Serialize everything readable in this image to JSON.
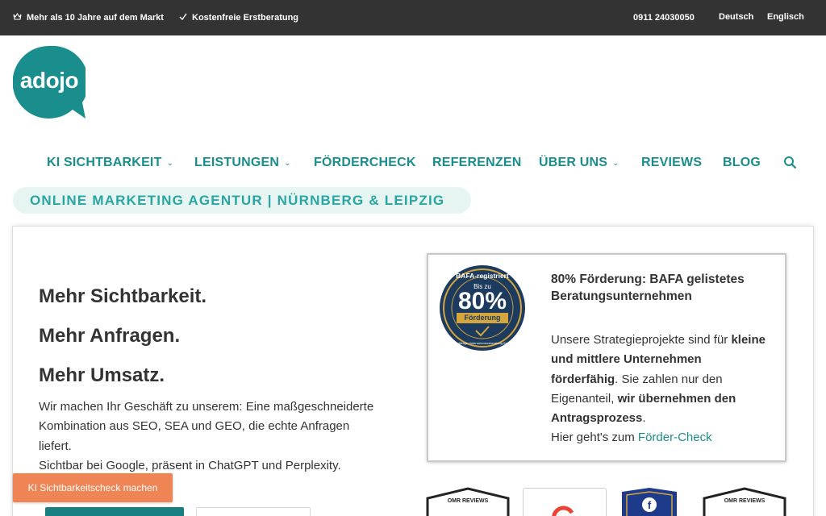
{
  "topbar": {
    "left_items": [
      {
        "icon": "crown-icon",
        "text": "Mehr als 10 Jahre auf dem Markt"
      },
      {
        "icon": "check-icon",
        "text": "Kostenfreie Erstberatung"
      }
    ],
    "phone": "0911 24030050",
    "languages": [
      "Deutsch",
      "Englisch"
    ]
  },
  "logo": {
    "text": "adojo",
    "color": "#1a8d8d"
  },
  "nav": {
    "items": [
      {
        "label": "KI SICHTBARKEIT",
        "dropdown": true
      },
      {
        "label": "LEISTUNGEN",
        "dropdown": true
      },
      {
        "label": "FÖRDERCHECK",
        "dropdown": false
      },
      {
        "label": "REFERENZEN",
        "dropdown": false
      },
      {
        "label": "ÜBER UNS",
        "dropdown": true
      },
      {
        "label": "REVIEWS",
        "dropdown": false
      },
      {
        "label": "BLOG",
        "dropdown": false
      }
    ],
    "search_icon": "search-icon"
  },
  "tagline": "ONLINE MARKETING AGENTUR | NÜRNBERG & LEIPZIG",
  "hero": {
    "headlines": [
      "Mehr Sichtbarkeit.",
      "Mehr Anfragen.",
      "Mehr Umsatz."
    ],
    "body_lines": [
      "Wir machen Ihr Geschäft zu unserem: Eine maßgeschneiderte",
      "Kombination aus SEO, SEA und GEO, die echte Anfragen",
      "liefert.",
      "Sichtbar bei Google, präsent in ChatGPT und Perplexity."
    ]
  },
  "cta": {
    "label": "KI Sichtbarkeitscheck machen",
    "color": "#ef8454"
  },
  "bafa": {
    "badge": {
      "top": "BAFA-registriert",
      "small": "Bis zu",
      "big": "80%",
      "ribbon": "Förderung",
      "bottom": "Förderfähige Unternehmensberatung für KMU"
    },
    "title": "80% Förderung: BAFA gelistetes Beratungsunternehmen",
    "text_1": "Unsere Strategieprojekte sind für",
    "text_bold_1": "kleine und mittlere Unternehmen förderfähig",
    "text_2": ". Sie zahlen nur den Eigenanteil,",
    "text_bold_2": "wir übernehmen den Antragsprozess",
    "text_3": ".",
    "link_prefix": "Hier geht's zum",
    "link_label": "Förder-Check"
  },
  "review_badges": [
    {
      "name": "OMR REVIEWS"
    },
    {
      "name": "OMR REVIEWS"
    }
  ],
  "colors": {
    "teal": "#1a8d8d",
    "tagline_bg": "#e6f4f2",
    "topbar_bg": "#333333",
    "cta": "#ef8454"
  }
}
